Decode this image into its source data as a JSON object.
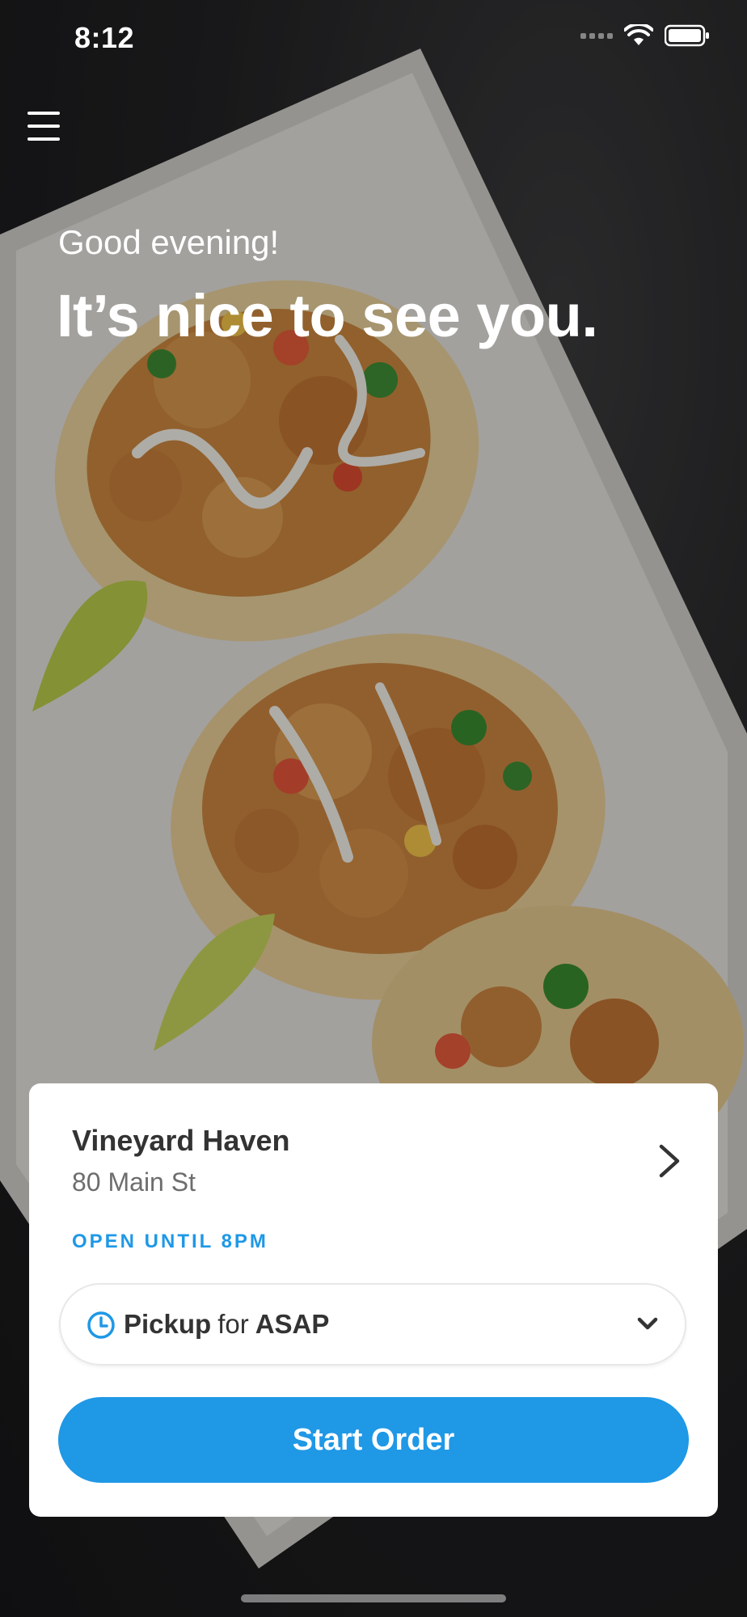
{
  "status_bar": {
    "time": "8:12"
  },
  "header": {
    "greeting": "Good evening!",
    "headline": "It’s nice to see you."
  },
  "store_card": {
    "name": "Vineyard Haven",
    "address": "80 Main St",
    "hours": "OPEN UNTIL 8PM",
    "order_type": "Pickup",
    "order_for": "for",
    "order_time": "ASAP",
    "start_button": "Start Order"
  },
  "colors": {
    "accent": "#1f98e6",
    "text_dark": "#333333",
    "text_muted": "#6d6d6d"
  },
  "icons": {
    "menu": "hamburger-icon",
    "store_chevron": "chevron-right-icon",
    "clock": "clock-icon",
    "dropdown": "chevron-down-icon",
    "wifi": "wifi-icon",
    "battery": "battery-icon"
  }
}
